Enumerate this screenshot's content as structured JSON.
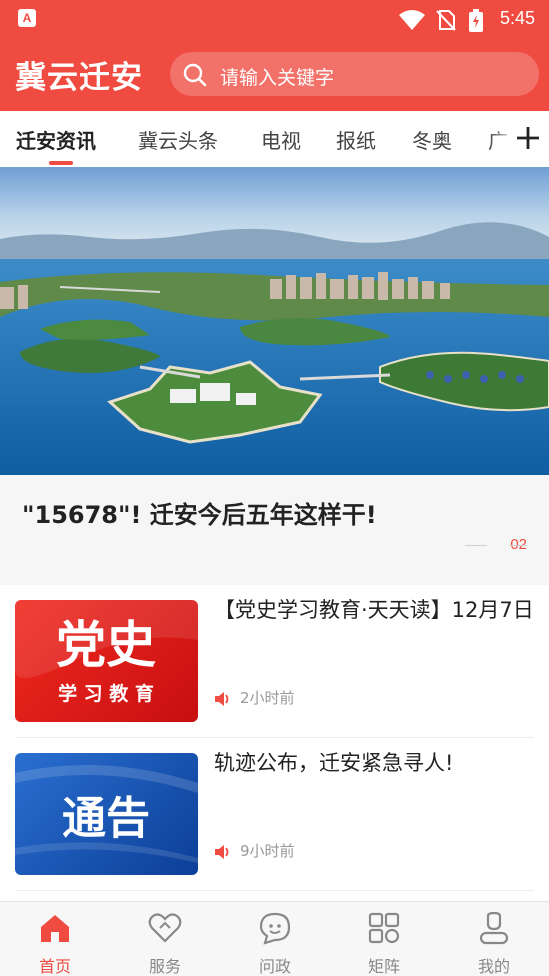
{
  "status_bar": {
    "time": "5:45",
    "app_badge": "A"
  },
  "header": {
    "title": "冀云迁安",
    "search_placeholder": "请输入关键字"
  },
  "tabs": [
    {
      "label": "迁安资讯"
    },
    {
      "label": "冀云头条"
    },
    {
      "label": "电视"
    },
    {
      "label": "报纸"
    },
    {
      "label": "冬奥"
    },
    {
      "label": "广"
    }
  ],
  "headline": {
    "title": "\"15678\"! 迁安今后五年这样干!",
    "page": "02"
  },
  "news": [
    {
      "title": "【党史学习教育·天天读】12月7日",
      "time": "2小时前",
      "thumb_main": "党史",
      "thumb_sub": "学 习 教 育"
    },
    {
      "title": "轨迹公布，迁安紧急寻人!",
      "time": "9小时前",
      "thumb_main": "通告"
    }
  ],
  "bottom_nav": [
    {
      "label": "首页",
      "icon": "home-icon"
    },
    {
      "label": "服务",
      "icon": "heart-icon"
    },
    {
      "label": "问政",
      "icon": "chat-icon"
    },
    {
      "label": "矩阵",
      "icon": "grid-icon"
    },
    {
      "label": "我的",
      "icon": "person-icon"
    }
  ],
  "colors": {
    "brand": "#ef4b41",
    "text": "#222222",
    "muted": "#999999"
  }
}
